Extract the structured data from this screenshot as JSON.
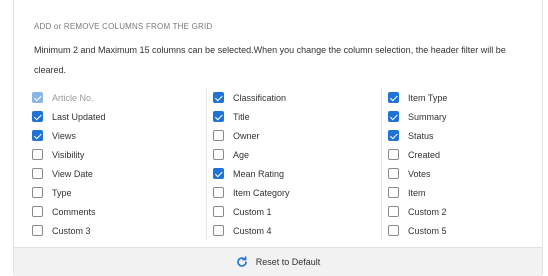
{
  "header": {
    "title": "ADD or REMOVE COLUMNS FROM THE GRID",
    "description": "Minimum 2 and Maximum 15 columns can be selected.When you change the column selection, the header filter will be cleared."
  },
  "columns": [
    [
      {
        "label": "Article No.",
        "checked": true,
        "disabled": true
      },
      {
        "label": "Last Updated",
        "checked": true
      },
      {
        "label": "Views",
        "checked": true
      },
      {
        "label": "Visibility",
        "checked": false
      },
      {
        "label": "View Date",
        "checked": false
      },
      {
        "label": "Type",
        "checked": false
      },
      {
        "label": "Comments",
        "checked": false
      },
      {
        "label": "Custom 3",
        "checked": false
      }
    ],
    [
      {
        "label": "Classification",
        "checked": true
      },
      {
        "label": "Title",
        "checked": true
      },
      {
        "label": "Owner",
        "checked": false
      },
      {
        "label": "Age",
        "checked": false
      },
      {
        "label": "Mean Rating",
        "checked": true
      },
      {
        "label": "Item Category",
        "checked": false
      },
      {
        "label": "Custom 1",
        "checked": false
      },
      {
        "label": "Custom 4",
        "checked": false
      }
    ],
    [
      {
        "label": "Item Type",
        "checked": true
      },
      {
        "label": "Summary",
        "checked": true
      },
      {
        "label": "Status",
        "checked": true
      },
      {
        "label": "Created",
        "checked": false
      },
      {
        "label": "Votes",
        "checked": false
      },
      {
        "label": "Item",
        "checked": false
      },
      {
        "label": "Custom 2",
        "checked": false
      },
      {
        "label": "Custom 5",
        "checked": false
      }
    ]
  ],
  "footer": {
    "reset_label": "Reset to Default",
    "reset_icon": "refresh-icon"
  },
  "colors": {
    "checkbox_checked": "#1f72d6",
    "checkbox_disabled": "#8ab4e8",
    "footer_bg": "#f2f2f2"
  }
}
